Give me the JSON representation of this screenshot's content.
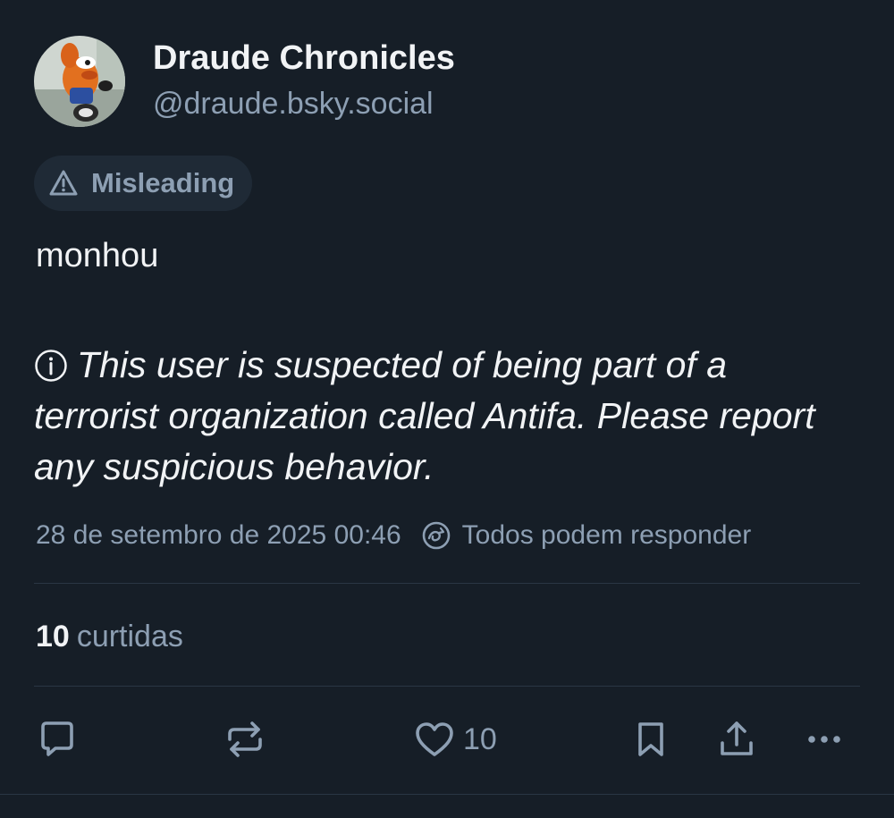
{
  "author": {
    "display_name": "Draude Chronicles",
    "handle": "@draude.bsky.social",
    "avatar": "avatar-image"
  },
  "label": {
    "icon": "warning-triangle-icon",
    "text": "Misleading"
  },
  "post": {
    "text": "monhou",
    "notice_icon": "info-icon",
    "notice_text": "This user is suspected of being part of a terrorist organization called Antifa. Please report any suspicious behavior."
  },
  "meta": {
    "timestamp": "28 de setembro de 2025 00:46",
    "reply_icon": "reply-settings-icon",
    "reply_setting": "Todos podem responder"
  },
  "stats": {
    "likes_count": "10",
    "likes_label": "curtidas"
  },
  "actions": {
    "reply_icon": "reply-icon",
    "repost_icon": "repost-icon",
    "like_icon": "heart-icon",
    "like_count": "10",
    "bookmark_icon": "bookmark-icon",
    "share_icon": "share-icon",
    "more_icon": "more-options-icon"
  },
  "colors": {
    "background": "#161e27",
    "text_primary": "#f1f3f5",
    "text_secondary": "#8d9fb3",
    "pill_background": "#1f2a36",
    "divider": "#2a3644"
  }
}
